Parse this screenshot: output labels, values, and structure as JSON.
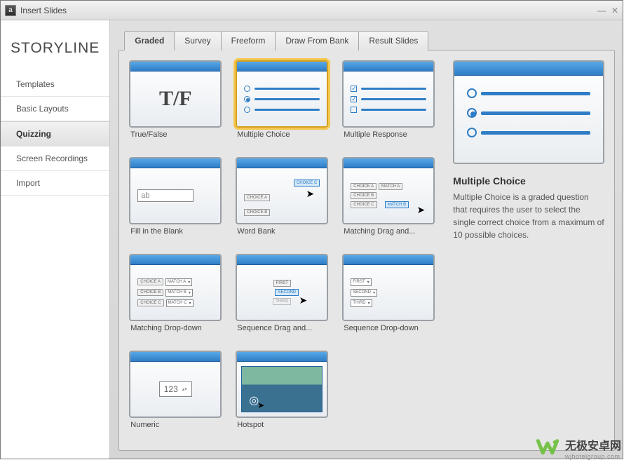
{
  "window": {
    "title": "Insert Slides"
  },
  "logo": "STORYLINE",
  "sidebar": {
    "items": [
      {
        "label": "Templates"
      },
      {
        "label": "Basic Layouts"
      },
      {
        "label": "Quizzing",
        "active": true
      },
      {
        "label": "Screen Recordings"
      },
      {
        "label": "Import"
      }
    ]
  },
  "tabs": [
    {
      "label": "Graded",
      "active": true
    },
    {
      "label": "Survey"
    },
    {
      "label": "Freeform"
    },
    {
      "label": "Draw From Bank"
    },
    {
      "label": "Result Slides"
    }
  ],
  "cards": [
    {
      "label": "True/False",
      "kind": "tf"
    },
    {
      "label": "Multiple Choice",
      "kind": "mc",
      "selected": true
    },
    {
      "label": "Multiple Response",
      "kind": "mr"
    },
    {
      "label": "Fill in the Blank",
      "kind": "fib"
    },
    {
      "label": "Word Bank",
      "kind": "wb"
    },
    {
      "label": "Matching Drag  and...",
      "kind": "mdd"
    },
    {
      "label": "Matching Drop-down",
      "kind": "mdrop"
    },
    {
      "label": "Sequence Drag  and...",
      "kind": "sdd"
    },
    {
      "label": "Sequence Drop-down",
      "kind": "sdrop"
    },
    {
      "label": "Numeric",
      "kind": "num"
    },
    {
      "label": "Hotspot",
      "kind": "hs"
    }
  ],
  "preview": {
    "title": "Multiple Choice",
    "description": "Multiple Choice is a graded question that requires the user to select the single correct choice from a maximum of 10 possible choices."
  },
  "watermark": {
    "cn": "无极安卓网",
    "en": "wjhotelgroup.com"
  },
  "chips": {
    "choiceA": "CHOICE A",
    "choiceB": "CHOICE B",
    "choiceC": "CHOICE C",
    "matchA": "MATCH A",
    "matchB": "MATCH B",
    "matchC": "MATCH C",
    "first": "FIRST",
    "second": "SECOND",
    "third": "THIRD",
    "ab": "ab",
    "num": "123"
  }
}
